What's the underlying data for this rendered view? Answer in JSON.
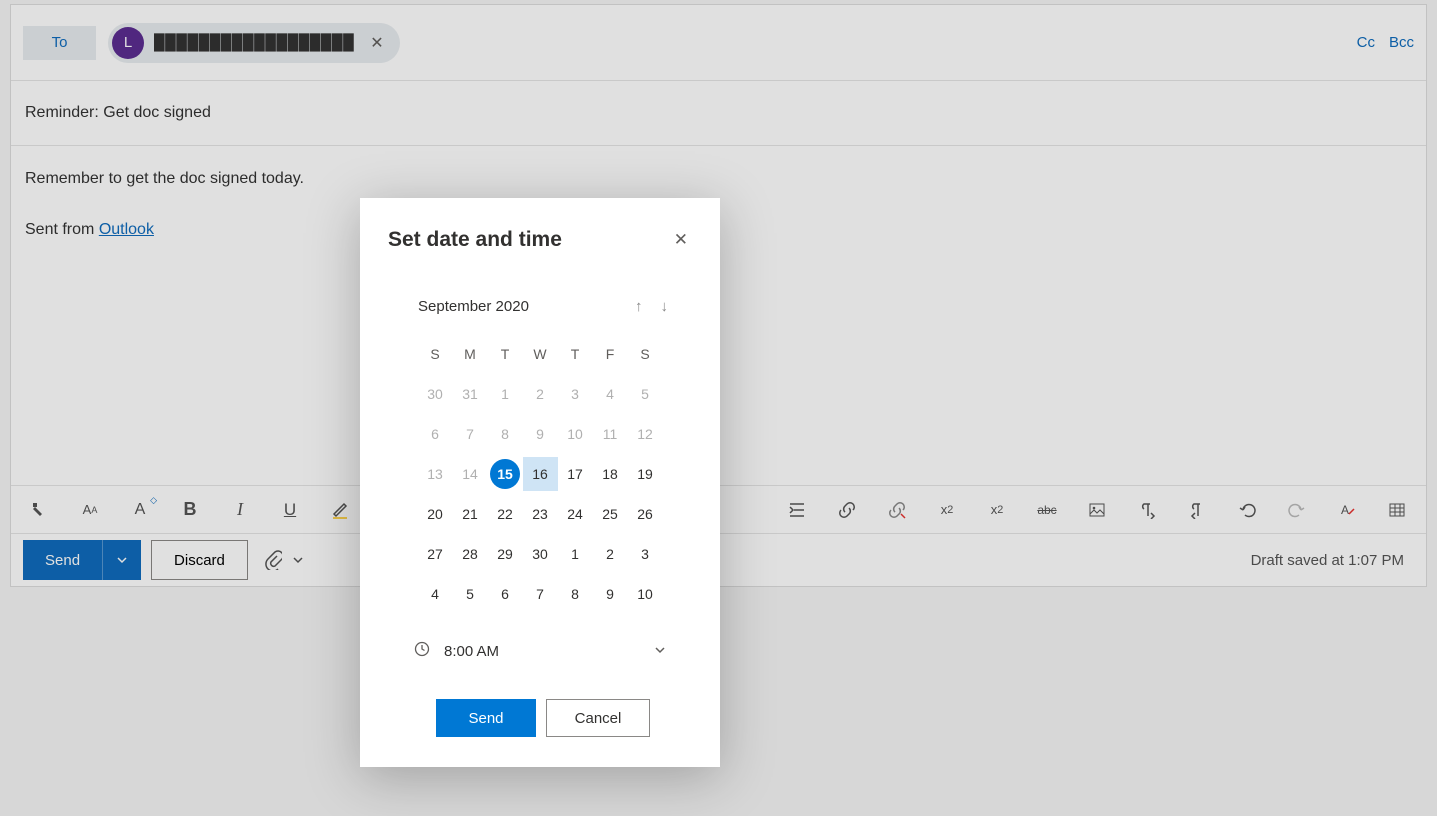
{
  "compose": {
    "to_label": "To",
    "recipient": {
      "initial": "L",
      "name": "██████████████████"
    },
    "cc_label": "Cc",
    "bcc_label": "Bcc",
    "subject": "Reminder: Get doc signed",
    "body_line1": "Remember to get the doc signed today.",
    "body_sent_prefix": "Sent from ",
    "body_sent_link": "Outlook"
  },
  "toolbar": {
    "icons": [
      "format-painter",
      "font-size",
      "font-color-case",
      "bold",
      "italic",
      "underline",
      "highlight",
      "text-color"
    ]
  },
  "sendbar": {
    "send": "Send",
    "discard": "Discard",
    "draft_status": "Draft saved at 1:07 PM"
  },
  "modal": {
    "title": "Set date and time",
    "month": "September 2020",
    "dow": [
      "S",
      "M",
      "T",
      "W",
      "T",
      "F",
      "S"
    ],
    "weeks": [
      [
        {
          "d": "30",
          "m": true
        },
        {
          "d": "31",
          "m": true
        },
        {
          "d": "1",
          "m": true
        },
        {
          "d": "2",
          "m": true
        },
        {
          "d": "3",
          "m": true
        },
        {
          "d": "4",
          "m": true
        },
        {
          "d": "5",
          "m": true
        }
      ],
      [
        {
          "d": "6",
          "m": true
        },
        {
          "d": "7",
          "m": true
        },
        {
          "d": "8",
          "m": true
        },
        {
          "d": "9",
          "m": true
        },
        {
          "d": "10",
          "m": true
        },
        {
          "d": "11",
          "m": true
        },
        {
          "d": "12",
          "m": true
        }
      ],
      [
        {
          "d": "13",
          "m": true
        },
        {
          "d": "14",
          "m": true
        },
        {
          "d": "15",
          "sel": true
        },
        {
          "d": "16",
          "hov": true
        },
        {
          "d": "17"
        },
        {
          "d": "18"
        },
        {
          "d": "19"
        }
      ],
      [
        {
          "d": "20"
        },
        {
          "d": "21"
        },
        {
          "d": "22"
        },
        {
          "d": "23"
        },
        {
          "d": "24"
        },
        {
          "d": "25"
        },
        {
          "d": "26"
        }
      ],
      [
        {
          "d": "27"
        },
        {
          "d": "28"
        },
        {
          "d": "29"
        },
        {
          "d": "30"
        },
        {
          "d": "1"
        },
        {
          "d": "2"
        },
        {
          "d": "3"
        }
      ],
      [
        {
          "d": "4"
        },
        {
          "d": "5"
        },
        {
          "d": "6"
        },
        {
          "d": "7"
        },
        {
          "d": "8"
        },
        {
          "d": "9"
        },
        {
          "d": "10"
        }
      ]
    ],
    "time": "8:00 AM",
    "send": "Send",
    "cancel": "Cancel"
  }
}
